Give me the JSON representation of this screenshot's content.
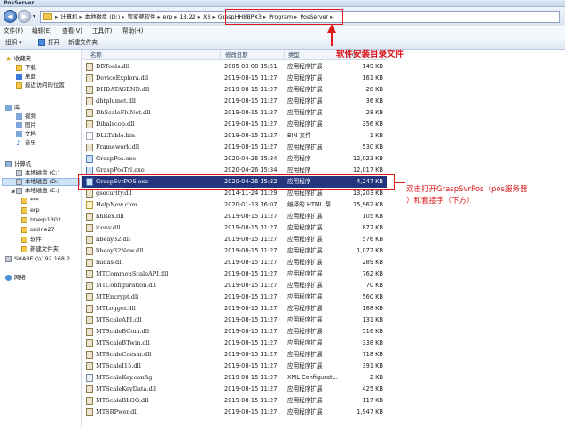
{
  "window": {
    "title": "PosServer"
  },
  "address": {
    "crumbs": [
      "计算机",
      "本地磁盘 (D:)",
      "管家婆软件",
      "erp",
      "13.22",
      "X3",
      "GraspHH8BPX3",
      "Program",
      "PosServer"
    ],
    "separator": "▸"
  },
  "menu": [
    "文件(F)",
    "编辑(E)",
    "查看(V)",
    "工具(T)",
    "帮助(H)"
  ],
  "toolbar": {
    "organize": "组织 ▾",
    "open": "打开",
    "new_folder": "新建文件夹"
  },
  "sidebar": {
    "favorites": "收藏夹",
    "fav_items": [
      "下载",
      "桌面",
      "最近访问的位置"
    ],
    "library": "库",
    "lib_items": [
      "视频",
      "图片",
      "文档",
      "音乐"
    ],
    "computer": "计算机",
    "drives": [
      "本地磁盘 (C:)",
      "本地磁盘 (D:)",
      "本地磁盘 (E:)"
    ],
    "e_folders": [
      "***",
      "erp",
      "hberp1302",
      "online27",
      "软件",
      "新建文件夹"
    ],
    "share": "SHARE (\\\\192.168.2",
    "network": "网络"
  },
  "columns": {
    "name": "名称",
    "date": "修改日期",
    "type": "类型",
    "size": "大小"
  },
  "files": [
    {
      "name": "DBTools.dll",
      "date": "2005-03-08 15:51",
      "type": "应用程序扩展",
      "size": "149 KB",
      "icon": "dll"
    },
    {
      "name": "DeviceExplora.dll",
      "date": "2019-08-15 11:27",
      "type": "应用程序扩展",
      "size": "161 KB",
      "icon": "dll"
    },
    {
      "name": "DHDATASEND.dll",
      "date": "2019-08-15 11:27",
      "type": "应用程序扩展",
      "size": "28 KB",
      "icon": "dll"
    },
    {
      "name": "dhtplumet.dll",
      "date": "2019-08-15 11:27",
      "type": "应用程序扩展",
      "size": "36 KB",
      "icon": "dll"
    },
    {
      "name": "DhScaleFluNet.dll",
      "date": "2019-08-15 11:27",
      "type": "应用程序扩展",
      "size": "28 KB",
      "icon": "dll"
    },
    {
      "name": "Dibalscop.dll",
      "date": "2019-08-15 11:27",
      "type": "应用程序扩展",
      "size": "356 KB",
      "icon": "dll"
    },
    {
      "name": "DLLTable.bin",
      "date": "2019-08-15 11:27",
      "type": "BIN 文件",
      "size": "1 KB",
      "icon": "file"
    },
    {
      "name": "Framework.dll",
      "date": "2019-08-15 11:27",
      "type": "应用程序扩展",
      "size": "530 KB",
      "icon": "dll"
    },
    {
      "name": "GraspPos.exe",
      "date": "2020-04-26 15:34",
      "type": "应用程序",
      "size": "12,023 KB",
      "icon": "exe"
    },
    {
      "name": "GraspPosTrl.exe",
      "date": "2020-04-26 15:34",
      "type": "应用程序",
      "size": "12,017 KB",
      "icon": "exe"
    },
    {
      "name": "GraspSvrPOS.exe",
      "date": "2020-04-26 15:32",
      "type": "应用程序",
      "size": "4,247 KB",
      "icon": "exe",
      "selected": true
    },
    {
      "name": "gsecurity.dll",
      "date": "2014-11-24 11:29",
      "type": "应用程序扩展",
      "size": "13,203 KB",
      "icon": "dll"
    },
    {
      "name": "HelpNew.chm",
      "date": "2020-01-13 16:07",
      "type": "编译的 HTML 帮...",
      "size": "15,962 KB",
      "icon": "help"
    },
    {
      "name": "hhRex.dll",
      "date": "2019-08-15 11:27",
      "type": "应用程序扩展",
      "size": "105 KB",
      "icon": "dll"
    },
    {
      "name": "iconv.dll",
      "date": "2019-08-15 11:27",
      "type": "应用程序扩展",
      "size": "872 KB",
      "icon": "dll"
    },
    {
      "name": "libeay32.dll",
      "date": "2019-08-15 11:27",
      "type": "应用程序扩展",
      "size": "576 KB",
      "icon": "dll"
    },
    {
      "name": "libeay32New.dll",
      "date": "2019-08-15 11:27",
      "type": "应用程序扩展",
      "size": "1,072 KB",
      "icon": "dll"
    },
    {
      "name": "midas.dll",
      "date": "2019-08-15 11:27",
      "type": "应用程序扩展",
      "size": "289 KB",
      "icon": "dll"
    },
    {
      "name": "MTCommonScaleAPI.dll",
      "date": "2019-08-15 11:27",
      "type": "应用程序扩展",
      "size": "762 KB",
      "icon": "dll"
    },
    {
      "name": "MTConfiguration.dll",
      "date": "2019-08-15 11:27",
      "type": "应用程序扩展",
      "size": "70 KB",
      "icon": "dll"
    },
    {
      "name": "MTEncrypt.dll",
      "date": "2019-08-15 11:27",
      "type": "应用程序扩展",
      "size": "560 KB",
      "icon": "dll"
    },
    {
      "name": "MTLogger.dll",
      "date": "2019-08-15 11:27",
      "type": "应用程序扩展",
      "size": "188 KB",
      "icon": "dll"
    },
    {
      "name": "MTScaleAPI.dll",
      "date": "2019-08-15 11:27",
      "type": "应用程序扩展",
      "size": "131 KB",
      "icon": "dll"
    },
    {
      "name": "MTScaleBCom.dll",
      "date": "2019-08-15 11:27",
      "type": "应用程序扩展",
      "size": "516 KB",
      "icon": "dll"
    },
    {
      "name": "MTScaleBTwin.dll",
      "date": "2019-08-15 11:27",
      "type": "应用程序扩展",
      "size": "338 KB",
      "icon": "dll"
    },
    {
      "name": "MTScaleCaesar.dll",
      "date": "2019-08-15 11:27",
      "type": "应用程序扩展",
      "size": "718 KB",
      "icon": "dll"
    },
    {
      "name": "MTScaleI15.dll",
      "date": "2019-08-15 11:27",
      "type": "应用程序扩展",
      "size": "391 KB",
      "icon": "dll"
    },
    {
      "name": "MTScaleKey.config",
      "date": "2019-08-15 11:27",
      "type": "XML Configurat...",
      "size": "2 KB",
      "icon": "cfg"
    },
    {
      "name": "MTScaleKeyData.dll",
      "date": "2019-08-15 11:27",
      "type": "应用程序扩展",
      "size": "425 KB",
      "icon": "dll"
    },
    {
      "name": "MTScaleBLOO.dll",
      "date": "2019-08-15 11:27",
      "type": "应用程序扩展",
      "size": "117 KB",
      "icon": "dll"
    },
    {
      "name": "MTSRPwer.dll",
      "date": "2019-08-15 11:27",
      "type": "应用程序扩展",
      "size": "1,947 KB",
      "icon": "dll"
    }
  ],
  "annotations": {
    "install_dir": "软件安装目录文件",
    "double_click": "双击打开GraspSvrPos（pos服务器",
    "double_click_2": "）和套接字（下方）"
  },
  "colors": {
    "annotation_red": "#e0191b",
    "selection": "#24357d"
  }
}
